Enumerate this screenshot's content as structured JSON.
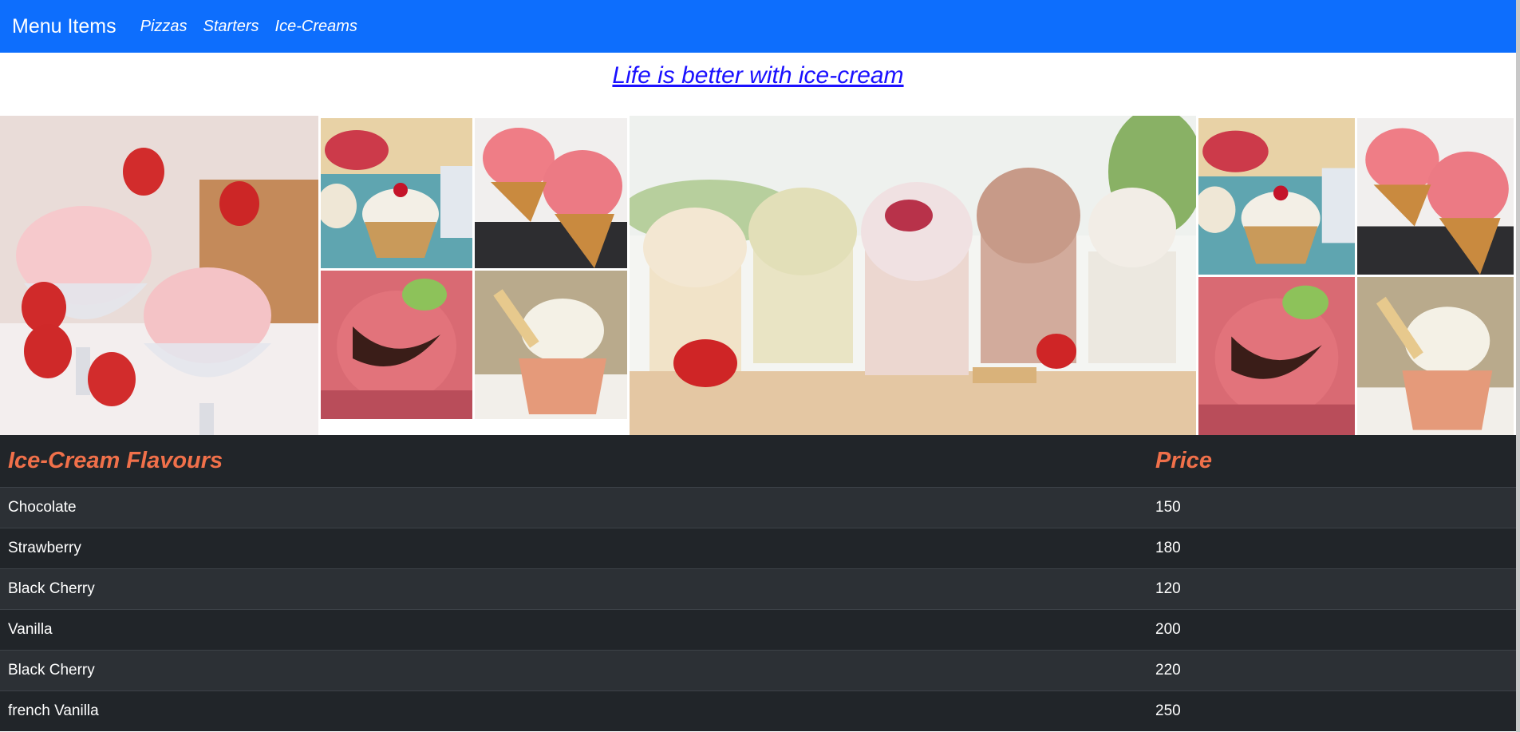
{
  "navbar": {
    "brand": "Menu Items",
    "links": [
      "Pizzas",
      "Starters",
      "Ice-Creams"
    ]
  },
  "tagline": "Life is better with ice-cream",
  "gallery": {
    "images": [
      "strawberry-ice-cream-bowls",
      "sundae-cups-collage",
      "pink-ice-cream-cones",
      "chocolate-drizzle-scoop",
      "vanilla-cup-with-spoon",
      "ice-cream-jars-row",
      "sundae-cups-collage",
      "pink-ice-cream-cones",
      "chocolate-drizzle-scoop",
      "vanilla-cup-with-spoon"
    ]
  },
  "table": {
    "headers": [
      "Ice-Cream Flavours",
      "Price"
    ],
    "rows": [
      {
        "flavour": "Chocolate",
        "price": "150"
      },
      {
        "flavour": "Strawberry",
        "price": "180"
      },
      {
        "flavour": "Black Cherry",
        "price": "120"
      },
      {
        "flavour": "Vanilla",
        "price": "200"
      },
      {
        "flavour": "Black Cherry",
        "price": "220"
      },
      {
        "flavour": "french Vanilla",
        "price": "250"
      }
    ]
  },
  "colors": {
    "navbar": "#0d6efd",
    "link": "#1a10ff",
    "table_header": "#f0704a",
    "table_bg": "#212529",
    "table_stripe": "#2c3035"
  }
}
